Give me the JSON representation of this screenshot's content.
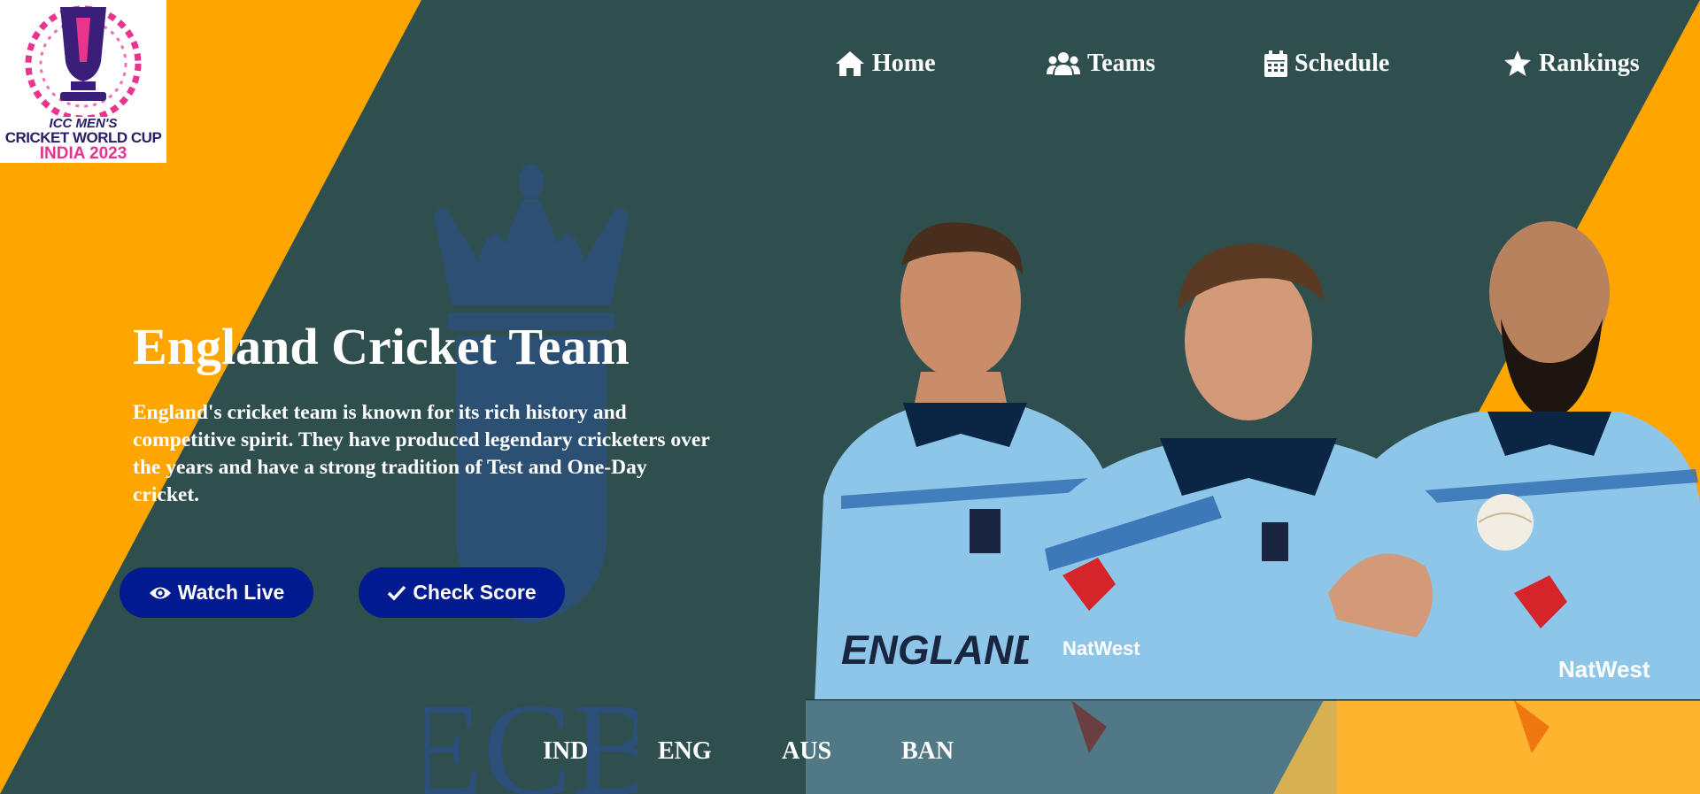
{
  "logo": {
    "line1": "ICC MEN'S",
    "line2": "CRICKET WORLD CUP",
    "line3": "INDIA 2023"
  },
  "nav": {
    "items": [
      {
        "label": "Home",
        "icon": "home-icon"
      },
      {
        "label": "Teams",
        "icon": "users-icon"
      },
      {
        "label": "Schedule",
        "icon": "calendar-icon"
      },
      {
        "label": "Rankings",
        "icon": "star-icon"
      }
    ]
  },
  "watermark": {
    "text": "ECB"
  },
  "hero": {
    "title": "England Cricket Team",
    "description": "England's cricket team is known for its rich history and competitive spirit. They have produced legendary cricketers over the years and have a strong tradition of Test and One-Day cricket.",
    "buttons": [
      {
        "label": "Watch Live",
        "icon": "eye-icon"
      },
      {
        "label": "Check Score",
        "icon": "check-icon"
      }
    ]
  },
  "players_photo": {
    "jersey_texts": [
      "ENGLAND",
      "NatWest",
      "NatWest"
    ]
  },
  "team_tabs": [
    "IND",
    "ENG",
    "AUS",
    "BAN"
  ],
  "colors": {
    "background": "#2f4f4f",
    "accent": "#ffa500",
    "button": "#001a8f",
    "text": "#ffffff"
  }
}
